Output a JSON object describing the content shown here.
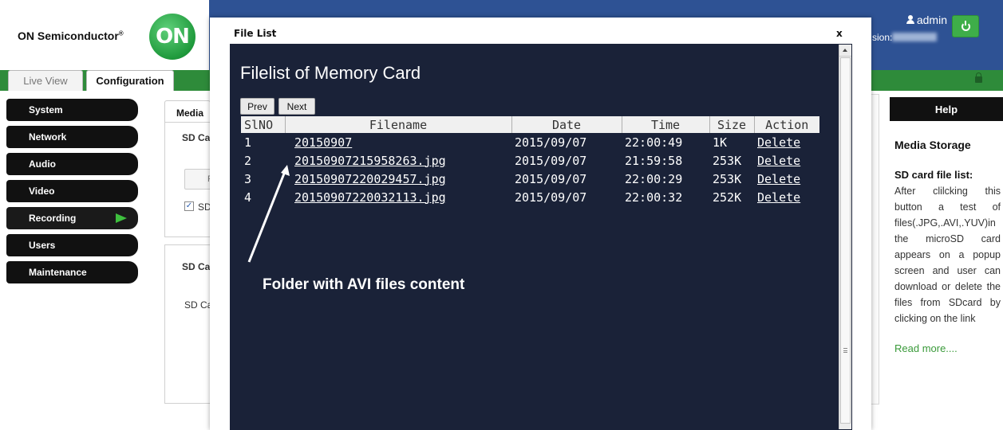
{
  "header": {
    "brand": "ON Semiconductor",
    "brand_mark": "®",
    "logo_text": "ON",
    "user": "admin",
    "version_label": "sion:"
  },
  "tabs": [
    {
      "label": "Live View",
      "active": false
    },
    {
      "label": "Configuration",
      "active": true
    }
  ],
  "sidebar": {
    "items": [
      {
        "label": "System"
      },
      {
        "label": "Network"
      },
      {
        "label": "Audio"
      },
      {
        "label": "Video"
      },
      {
        "label": "Recording",
        "active": true
      },
      {
        "label": "Users"
      },
      {
        "label": "Maintenance"
      }
    ]
  },
  "content": {
    "tab": "Media",
    "section1_label": "SD Ca",
    "button_label": "F",
    "checkbox_label": "SD",
    "checkbox_checked": true,
    "section2_label": "SD Ca",
    "section2_field": "SD Ca"
  },
  "help": {
    "title": "Help",
    "heading": "Media Storage",
    "subheading": "SD card file list:",
    "body": "After clilcking this button a test of files(.JPG,.AVI,.YUV)in the microSD card appears on a popup screen and user can download or delete the files from SDcard by clicking on the link",
    "link": "Read more...."
  },
  "modal": {
    "title": "File List",
    "close": "x",
    "heading": "Filelist of Memory Card",
    "prev": "Prev",
    "next": "Next",
    "columns": [
      "SlNO",
      "Filename",
      "Date",
      "Time",
      "Size",
      "Action"
    ],
    "rows": [
      {
        "sl": "1",
        "filename": "20150907",
        "date": "2015/09/07",
        "time": "22:00:49",
        "size": "1K",
        "action": "Delete"
      },
      {
        "sl": "2",
        "filename": "20150907215958263.jpg",
        "date": "2015/09/07",
        "time": "21:59:58",
        "size": "253K",
        "action": "Delete"
      },
      {
        "sl": "3",
        "filename": "20150907220029457.jpg",
        "date": "2015/09/07",
        "time": "22:00:29",
        "size": "253K",
        "action": "Delete"
      },
      {
        "sl": "4",
        "filename": "20150907220032113.jpg",
        "date": "2015/09/07",
        "time": "22:00:32",
        "size": "252K",
        "action": "Delete"
      }
    ],
    "annotation": "Folder with AVI files content"
  },
  "colors": {
    "header_blue": "#2e5294",
    "nav_green": "#2e8b3a",
    "modal_dark": "#1a2238",
    "active_arrow": "#3ebf3e",
    "link_green": "#3a9a3a"
  },
  "icons": [
    "user-icon",
    "power-icon",
    "lock-icon",
    "arrow-right-icon",
    "scroll-up-icon",
    "annotation-arrow"
  ]
}
